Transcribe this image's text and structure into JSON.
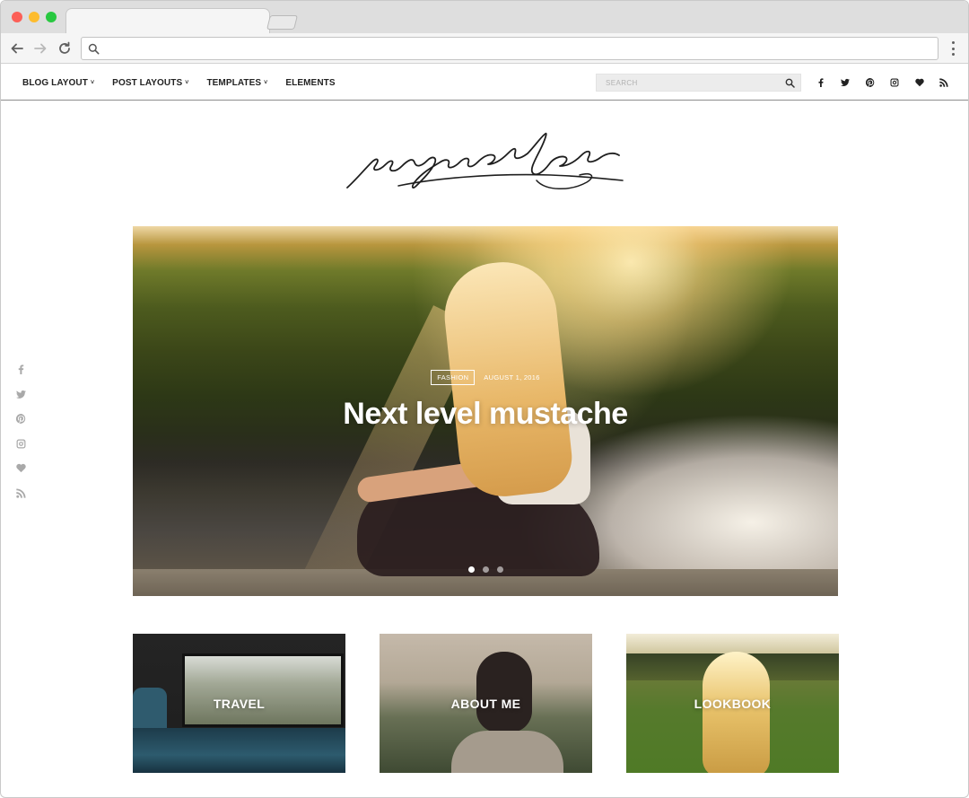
{
  "browser": {
    "address_value": "",
    "icons": {
      "back": "arrow-left-icon",
      "forward": "arrow-right-icon",
      "reload": "reload-icon",
      "search": "search-icon",
      "menu": "kebab-menu-icon"
    }
  },
  "nav": {
    "menu": [
      {
        "label": "BLOG LAYOUT",
        "has_dropdown": true
      },
      {
        "label": "POST LAYOUTS",
        "has_dropdown": true
      },
      {
        "label": "TEMPLATES",
        "has_dropdown": true
      },
      {
        "label": "ELEMENTS",
        "has_dropdown": false
      }
    ],
    "chevron": "˅",
    "search_placeholder": "SEARCH",
    "social": [
      "facebook-icon",
      "twitter-icon",
      "pinterest-icon",
      "instagram-icon",
      "heart-icon",
      "rss-icon"
    ]
  },
  "side_social": [
    "facebook-icon",
    "twitter-icon",
    "pinterest-icon",
    "instagram-icon",
    "heart-icon",
    "rss-icon"
  ],
  "hero": {
    "category": "FASHION",
    "date": "AUGUST 1, 2016",
    "title": "Next level mustache",
    "slides_count": 3,
    "active_slide": 1
  },
  "promos": [
    {
      "label": "TRAVEL"
    },
    {
      "label": "ABOUT ME"
    },
    {
      "label": "LOOKBOOK"
    }
  ],
  "colors": {
    "text_dark": "#222222",
    "social_grey": "#a9a9a9",
    "white": "#ffffff"
  }
}
